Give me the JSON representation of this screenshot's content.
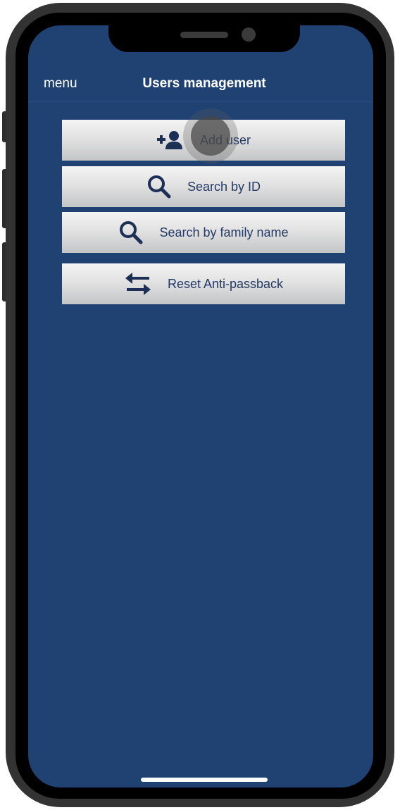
{
  "navbar": {
    "menu_label": "menu",
    "title": "Users management"
  },
  "buttons": [
    {
      "label": "Add user",
      "icon": "add-user-icon"
    },
    {
      "label": "Search by ID",
      "icon": "search-icon"
    },
    {
      "label": "Search by family name",
      "icon": "search-icon"
    },
    {
      "label": "Reset Anti-passback",
      "icon": "swap-arrows-icon"
    }
  ],
  "colors": {
    "screen_background": "#1f4273",
    "button_text": "#243a66",
    "icon": "#1c2f55"
  }
}
